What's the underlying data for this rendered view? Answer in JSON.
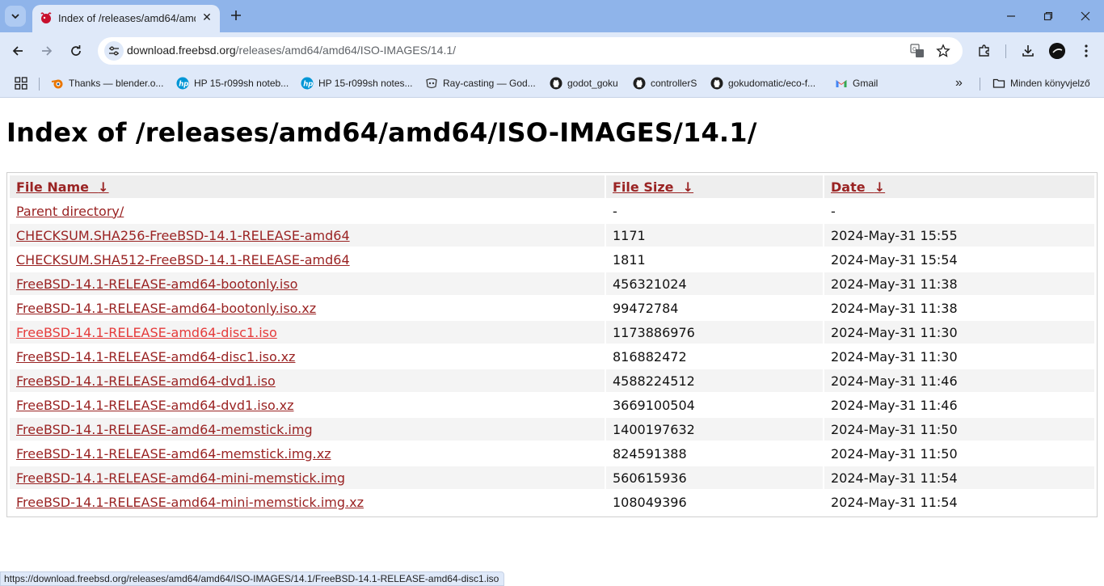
{
  "browser": {
    "tab": {
      "title": "Index of /releases/amd64/amd64/ISO-IMAGES/14.1/"
    },
    "address": {
      "host": "download.freebsd.org",
      "path": "/releases/amd64/amd64/ISO-IMAGES/14.1/"
    },
    "bookmarks": [
      {
        "label": "Thanks — blender.o...",
        "icon": "blender-icon"
      },
      {
        "label": "HP 15-r099sh noteb...",
        "icon": "hp-icon"
      },
      {
        "label": "HP 15-r099sh notes...",
        "icon": "hp-icon"
      },
      {
        "label": "Ray-casting — God...",
        "icon": "godot-icon"
      },
      {
        "label": "godot_goku",
        "icon": "github-icon"
      },
      {
        "label": "controllerS",
        "icon": "github-icon"
      },
      {
        "label": "gokudomatic/eco-f...",
        "icon": "github-icon"
      },
      {
        "label": "Gmail",
        "icon": "gmail-icon"
      }
    ],
    "overflow_label": "»",
    "all_bookmarks_label": "Minden könyvjelző",
    "status_url": "https://download.freebsd.org/releases/amd64/amd64/ISO-IMAGES/14.1/FreeBSD-14.1-RELEASE-amd64-disc1.iso"
  },
  "page": {
    "heading": "Index of /releases/amd64/amd64/ISO-IMAGES/14.1/",
    "columns": {
      "name": "File Name",
      "size": "File Size",
      "date": "Date",
      "sort_arrow": "↓"
    },
    "rows": [
      {
        "name": "Parent directory/",
        "size": "-",
        "date": "-"
      },
      {
        "name": "CHECKSUM.SHA256-FreeBSD-14.1-RELEASE-amd64",
        "size": "1171",
        "date": "2024-May-31 15:55"
      },
      {
        "name": "CHECKSUM.SHA512-FreeBSD-14.1-RELEASE-amd64",
        "size": "1811",
        "date": "2024-May-31 15:54"
      },
      {
        "name": "FreeBSD-14.1-RELEASE-amd64-bootonly.iso",
        "size": "456321024",
        "date": "2024-May-31 11:38"
      },
      {
        "name": "FreeBSD-14.1-RELEASE-amd64-bootonly.iso.xz",
        "size": "99472784",
        "date": "2024-May-31 11:38"
      },
      {
        "name": "FreeBSD-14.1-RELEASE-amd64-disc1.iso",
        "size": "1173886976",
        "date": "2024-May-31 11:30"
      },
      {
        "name": "FreeBSD-14.1-RELEASE-amd64-disc1.iso.xz",
        "size": "816882472",
        "date": "2024-May-31 11:30"
      },
      {
        "name": "FreeBSD-14.1-RELEASE-amd64-dvd1.iso",
        "size": "4588224512",
        "date": "2024-May-31 11:46"
      },
      {
        "name": "FreeBSD-14.1-RELEASE-amd64-dvd1.iso.xz",
        "size": "3669100504",
        "date": "2024-May-31 11:46"
      },
      {
        "name": "FreeBSD-14.1-RELEASE-amd64-memstick.img",
        "size": "1400197632",
        "date": "2024-May-31 11:50"
      },
      {
        "name": "FreeBSD-14.1-RELEASE-amd64-memstick.img.xz",
        "size": "824591388",
        "date": "2024-May-31 11:50"
      },
      {
        "name": "FreeBSD-14.1-RELEASE-amd64-mini-memstick.img",
        "size": "560615936",
        "date": "2024-May-31 11:54"
      },
      {
        "name": "FreeBSD-14.1-RELEASE-amd64-mini-memstick.img.xz",
        "size": "108049396",
        "date": "2024-May-31 11:54"
      }
    ]
  }
}
